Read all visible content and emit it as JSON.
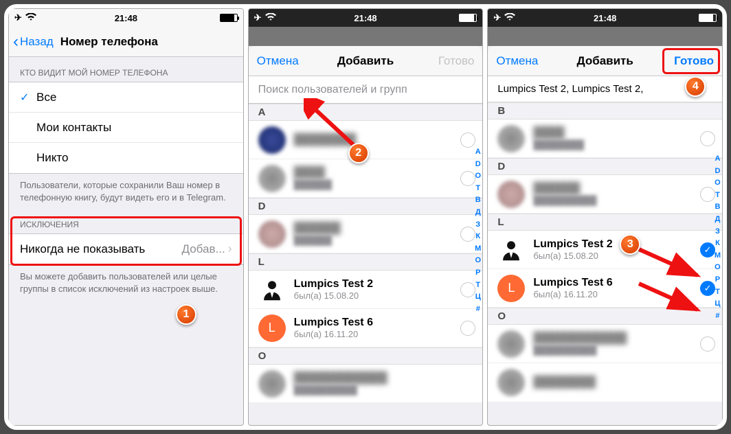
{
  "status": {
    "time": "21:48"
  },
  "p1": {
    "back": "Назад",
    "title": "Номер телефона",
    "section1_header": "КТО ВИДИТ МОЙ НОМЕР ТЕЛЕФОНА",
    "option_all": "Все",
    "option_contacts": "Мои контакты",
    "option_nobody": "Никто",
    "note1": "Пользователи, которые сохранили Ваш номер в телефонную книгу, будут видеть его и в Telegram.",
    "section2_header": "ИСКЛЮЧЕНИЯ",
    "never_show_label": "Никогда не показывать",
    "never_show_value": "Добав...",
    "note2": "Вы можете добавить пользователей или целые группы в список исключений из настроек выше."
  },
  "p2": {
    "cancel": "Отмена",
    "title": "Добавить",
    "done": "Готово",
    "search_placeholder": "Поиск пользователей и групп",
    "idx_a": "A",
    "idx_d": "D",
    "idx_l": "L",
    "idx_o": "O",
    "lumpics2_name": "Lumpics Test 2",
    "lumpics2_sub": "был(а) 15.08.20",
    "lumpics6_name": "Lumpics Test 6",
    "lumpics6_sub": "был(а) 16.11.20",
    "lumpics6_initial": "L",
    "alpha": [
      "A",
      "D",
      "O",
      "T",
      "В",
      "Д",
      "З",
      "К",
      "М",
      "О",
      "Р",
      "Т",
      "Ц",
      "#"
    ]
  },
  "p3": {
    "cancel": "Отмена",
    "title": "Добавить",
    "done": "Готово",
    "selected_summary": "Lumpics Test 2,  Lumpics Test 2,",
    "idx_b": "B",
    "idx_d": "D",
    "idx_l": "L",
    "idx_o": "O",
    "lumpics2_name": "Lumpics Test 2",
    "lumpics2_sub": "был(а) 15.08.20",
    "lumpics6_name": "Lumpics Test 6",
    "lumpics6_sub": "был(а) 16.11.20",
    "lumpics6_initial": "L",
    "alpha": [
      "A",
      "D",
      "O",
      "T",
      "В",
      "Д",
      "З",
      "К",
      "М",
      "О",
      "Р",
      "Т",
      "Ц",
      "#"
    ]
  },
  "markers": {
    "m1": "1",
    "m2": "2",
    "m3": "3",
    "m4": "4"
  }
}
